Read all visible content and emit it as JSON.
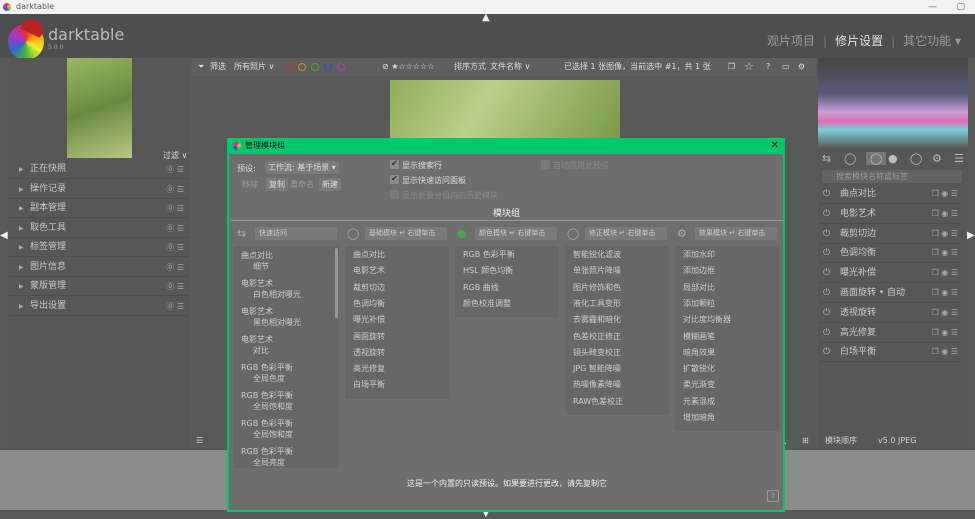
{
  "window": {
    "title": "darktable",
    "minimize": "—",
    "maximize": "▢"
  },
  "app": {
    "name": "darktable",
    "version": "5.0.0"
  },
  "views": {
    "lighttable": "观片项目",
    "darkroom": "修片设置",
    "other": "其它功能 ▾",
    "sep": "|"
  },
  "left": {
    "filter": "过滤 ∨",
    "modules": [
      "正在快照",
      "操作记录",
      "副本管理",
      "取色工具",
      "标签管理",
      "图片信息",
      "蒙版管理",
      "导出设置"
    ]
  },
  "toolbar": {
    "filter_label": "筛选",
    "filter_value": "所有照片 ∨",
    "color_labels": [
      "#d23030",
      "#d09020",
      "#30b030",
      "#3050d0",
      "#c030c0"
    ],
    "stars": "⊘ ★☆☆☆☆☆",
    "sort_label": "排序方式",
    "sort_value": "文件名称 ∨",
    "status": "已选择 1 张图像，当前选中 #1，共 1 张"
  },
  "right": {
    "tabs": [
      "⇆",
      "◯",
      "◯",
      "●",
      "◯",
      "⚙",
      "☰"
    ],
    "search_placeholder": "搜索模块名称或标签",
    "modules": [
      "曲点对比",
      "电影艺术",
      "裁剪切边",
      "色调均衡",
      "曝光补偿",
      "画面旋转 • 自动",
      "透视旋转",
      "高光修复",
      "白场平衡"
    ]
  },
  "bottom": {
    "module_order": "模块顺序",
    "version": "v5.0 JPEG"
  },
  "dialog": {
    "title": "管理模块组",
    "close": "✕",
    "preset_label": "预设:",
    "preset_value": "工作流: 基于场景 ▾",
    "buttons": {
      "remove": "移除",
      "duplicate": "复制",
      "rename": "重命名",
      "new": "新建"
    },
    "options": {
      "show_search": "显示搜索行",
      "show_quick": "显示快速访问面板",
      "show_history": "显示折叠分组内的历史模块",
      "auto_apply": "自动应用此预设"
    },
    "groups_title": "模块组",
    "quick_access": {
      "name": "快速访问",
      "items": [
        [
          "曲点对比",
          "细节"
        ],
        [
          "电影艺术",
          "白色相对曝光"
        ],
        [
          "电影艺术",
          "黑色相对曝光"
        ],
        [
          "电影艺术",
          "对比"
        ],
        [
          "RGB 色彩平衡",
          "全局色度"
        ],
        [
          "RGB 色彩平衡",
          "全局饱和度"
        ],
        [
          "RGB 色彩平衡",
          "全局饱和度"
        ],
        [
          "RGB 色彩平衡",
          "全局亮度"
        ]
      ]
    },
    "groups": [
      {
        "name": "基础模块 ↵ 右键单击",
        "icon": "◯",
        "items": [
          "曲点对比",
          "电影艺术",
          "裁剪切边",
          "色调均衡",
          "曝光补偿",
          "画面旋转",
          "透视旋转",
          "高光修复",
          "白场平衡"
        ]
      },
      {
        "name": "颜色模块 ↵ 右键单击",
        "icon": "●",
        "items": [
          "RGB 色彩平衡",
          "HSL 颜色均衡",
          "RGB 曲线",
          "颜色校准调整"
        ]
      },
      {
        "name": "修正模块 ↵ 右键单击",
        "icon": "◯",
        "items": [
          "智能锐化滤波",
          "单张照片降噪",
          "图片修饰和色",
          "液化工具变形",
          "去雾霾和暗化",
          "色差校正修正",
          "镜头畸变校正",
          "JPG 智能降噪",
          "热噪像素降噪",
          "RAW色差校正"
        ]
      },
      {
        "name": "效果模块 ↵ 右键单击",
        "icon": "⚙",
        "items": [
          "添加水印",
          "添加边框",
          "局部对比",
          "添加颗粒",
          "对比度均衡器",
          "模糊画笔",
          "暗角效果",
          "扩散锐化",
          "柔光渐变",
          "元素混成",
          "增加暗角"
        ]
      }
    ],
    "note": "这是一个内置的只读预设。如果要进行更改，请先复制它",
    "help": "?"
  }
}
